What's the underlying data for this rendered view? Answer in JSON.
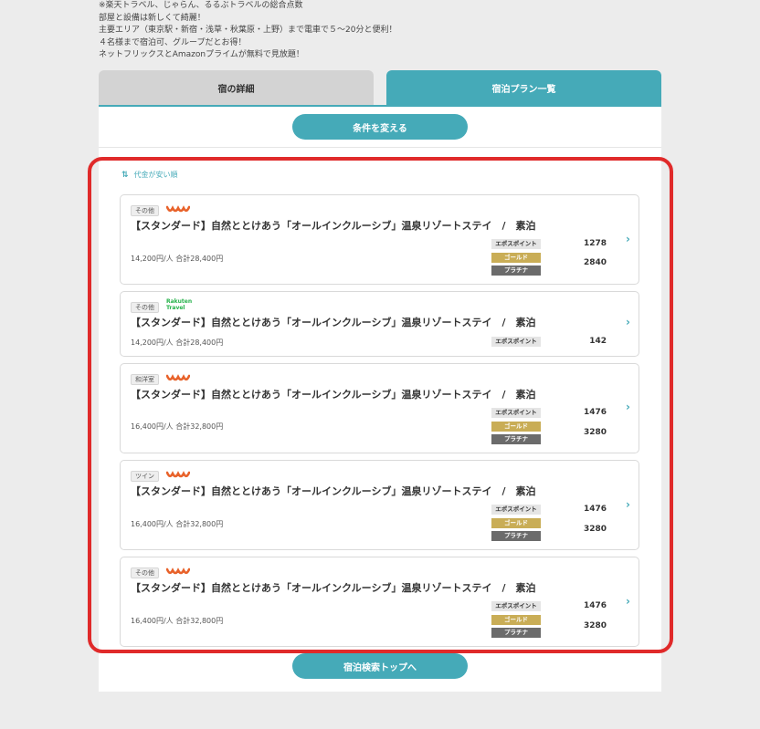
{
  "intro": {
    "lines": [
      "※楽天トラベル、じゃらん、るるぶトラベルの総合点数",
      "部屋と設備は新しくて綺麗！",
      "主要エリア（東京駅・新宿・浅草・秋葉原・上野）まで電車で５〜20分と便利！",
      "４名様まで宿泊可、グループだとお得！",
      "ネットフリックスとAmazonプライムが無料で見放題！"
    ]
  },
  "tabs": [
    {
      "label": "宿の詳細",
      "active": false
    },
    {
      "label": "宿泊プラン一覧",
      "active": true
    }
  ],
  "change_conditions_label": "条件を変える",
  "sort_label": "代金が安い順",
  "badge_labels": {
    "epos": "エポスポイント",
    "gold": "ゴールド",
    "plat": "プラチナ"
  },
  "plans": [
    {
      "room": "その他",
      "source": "jalan",
      "title": "【スタンダード】自然ととけあう「オールインクルーシブ」温泉リゾートステイ　/　素泊",
      "price": "14,200円/人 合計28,400円",
      "epos_points": "1278",
      "premium_points": "2840"
    },
    {
      "room": "その他",
      "source": "rakuten",
      "source_text": [
        "Rakuten",
        "Travel"
      ],
      "title": "【スタンダード】自然ととけあう「オールインクルーシブ」温泉リゾートステイ　/　素泊",
      "price": "14,200円/人 合計28,400円",
      "epos_points": "142"
    },
    {
      "room": "和洋室",
      "source": "jalan",
      "title": "【スタンダード】自然ととけあう「オールインクルーシブ」温泉リゾートステイ　/　素泊",
      "price": "16,400円/人 合計32,800円",
      "epos_points": "1476",
      "premium_points": "3280"
    },
    {
      "room": "ツイン",
      "source": "jalan",
      "title": "【スタンダード】自然ととけあう「オールインクルーシブ」温泉リゾートステイ　/　素泊",
      "price": "16,400円/人 合計32,800円",
      "epos_points": "1476",
      "premium_points": "3280"
    },
    {
      "room": "その他",
      "source": "jalan",
      "title": "【スタンダード】自然ととけあう「オールインクルーシブ」温泉リゾートステイ　/　素泊",
      "price": "16,400円/人 合計32,800円",
      "epos_points": "1476",
      "premium_points": "3280"
    }
  ],
  "back_to_top_label": "宿泊検索トップへ",
  "colors": {
    "accent": "#45aab8",
    "highlight": "#e02a2a",
    "gold": "#c9ad56",
    "platinum": "#6b6b6b",
    "jalan": "#e8622a",
    "rakuten": "#25b24a"
  }
}
